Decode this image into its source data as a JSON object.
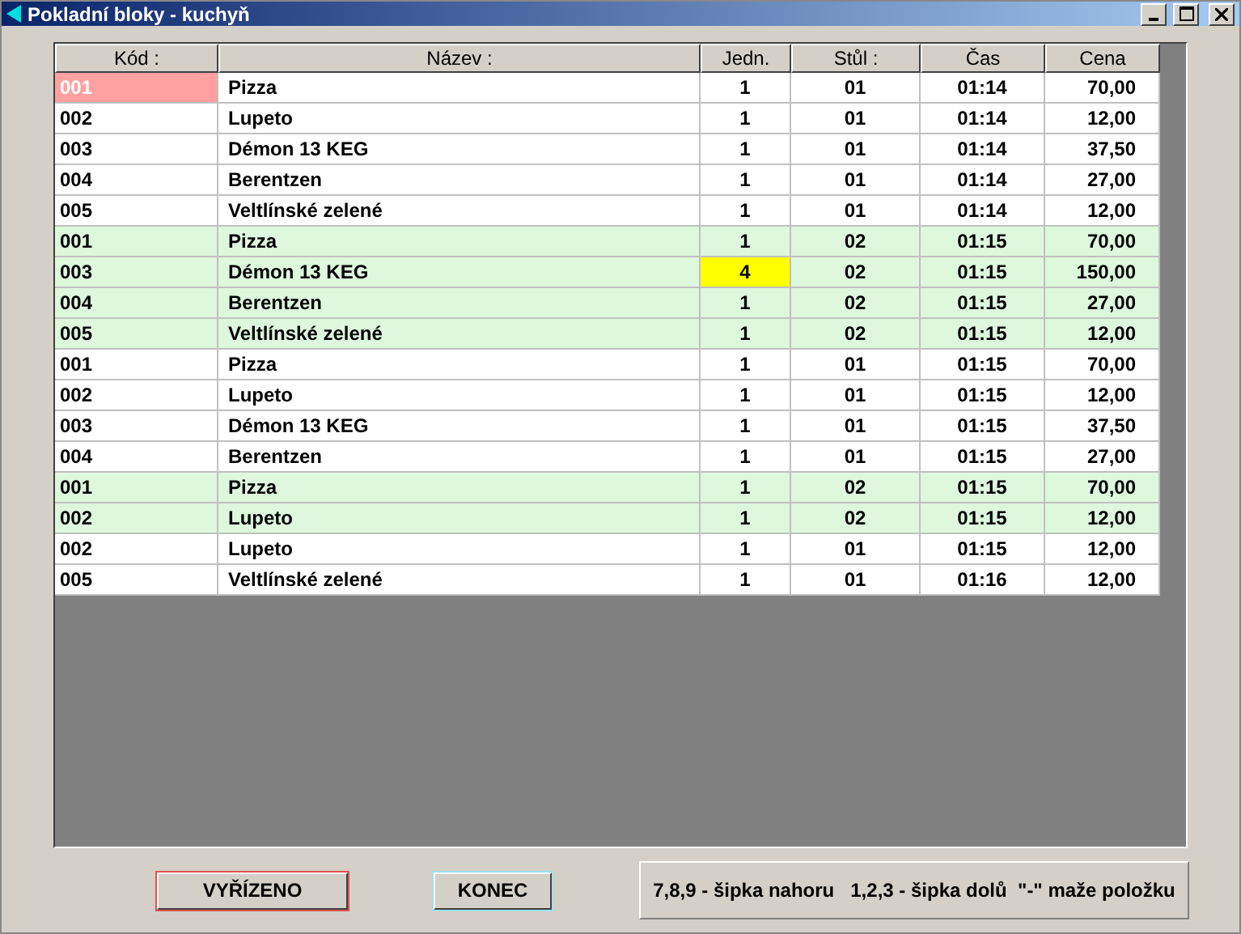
{
  "window": {
    "title": "Pokladní bloky - kuchyň"
  },
  "table": {
    "columns": [
      "Kód :",
      "Název :",
      "Jedn.",
      "Stůl :",
      "Čas",
      "Cena"
    ],
    "rows": [
      {
        "code": "001",
        "name": "Pizza",
        "qty": "1",
        "table": "01",
        "time": "01:14",
        "price": "70,00",
        "color": "#ffffff",
        "code_selected": true,
        "qty_selected": false
      },
      {
        "code": "002",
        "name": "Lupeto",
        "qty": "1",
        "table": "01",
        "time": "01:14",
        "price": "12,00",
        "color": "#ffffff",
        "code_selected": false,
        "qty_selected": false
      },
      {
        "code": "003",
        "name": "Démon 13 KEG",
        "qty": "1",
        "table": "01",
        "time": "01:14",
        "price": "37,50",
        "color": "#ffffff",
        "code_selected": false,
        "qty_selected": false
      },
      {
        "code": "004",
        "name": "Berentzen",
        "qty": "1",
        "table": "01",
        "time": "01:14",
        "price": "27,00",
        "color": "#ffffff",
        "code_selected": false,
        "qty_selected": false
      },
      {
        "code": "005",
        "name": "Veltlínské zelené",
        "qty": "1",
        "table": "01",
        "time": "01:14",
        "price": "12,00",
        "color": "#ffffff",
        "code_selected": false,
        "qty_selected": false
      },
      {
        "code": "001",
        "name": "Pizza",
        "qty": "1",
        "table": "02",
        "time": "01:15",
        "price": "70,00",
        "color": "#ddf8dd",
        "code_selected": false,
        "qty_selected": false
      },
      {
        "code": "003",
        "name": "Démon 13 KEG",
        "qty": "4",
        "table": "02",
        "time": "01:15",
        "price": "150,00",
        "color": "#ddf8dd",
        "code_selected": false,
        "qty_selected": true
      },
      {
        "code": "004",
        "name": "Berentzen",
        "qty": "1",
        "table": "02",
        "time": "01:15",
        "price": "27,00",
        "color": "#ddf8dd",
        "code_selected": false,
        "qty_selected": false
      },
      {
        "code": "005",
        "name": "Veltlínské zelené",
        "qty": "1",
        "table": "02",
        "time": "01:15",
        "price": "12,00",
        "color": "#ddf8dd",
        "code_selected": false,
        "qty_selected": false
      },
      {
        "code": "001",
        "name": "Pizza",
        "qty": "1",
        "table": "01",
        "time": "01:15",
        "price": "70,00",
        "color": "#ffffff",
        "code_selected": false,
        "qty_selected": false
      },
      {
        "code": "002",
        "name": "Lupeto",
        "qty": "1",
        "table": "01",
        "time": "01:15",
        "price": "12,00",
        "color": "#ffffff",
        "code_selected": false,
        "qty_selected": false
      },
      {
        "code": "003",
        "name": "Démon 13 KEG",
        "qty": "1",
        "table": "01",
        "time": "01:15",
        "price": "37,50",
        "color": "#ffffff",
        "code_selected": false,
        "qty_selected": false
      },
      {
        "code": "004",
        "name": "Berentzen",
        "qty": "1",
        "table": "01",
        "time": "01:15",
        "price": "27,00",
        "color": "#ffffff",
        "code_selected": false,
        "qty_selected": false
      },
      {
        "code": "001",
        "name": "Pizza",
        "qty": "1",
        "table": "02",
        "time": "01:15",
        "price": "70,00",
        "color": "#ddf8dd",
        "code_selected": false,
        "qty_selected": false
      },
      {
        "code": "002",
        "name": "Lupeto",
        "qty": "1",
        "table": "02",
        "time": "01:15",
        "price": "12,00",
        "color": "#ddf8dd",
        "code_selected": false,
        "qty_selected": false
      },
      {
        "code": "002",
        "name": "Lupeto",
        "qty": "1",
        "table": "01",
        "time": "01:15",
        "price": "12,00",
        "color": "#ffffff",
        "code_selected": false,
        "qty_selected": false
      },
      {
        "code": "005",
        "name": "Veltlínské zelené",
        "qty": "1",
        "table": "01",
        "time": "01:16",
        "price": "12,00",
        "color": "#ffffff",
        "code_selected": false,
        "qty_selected": false
      }
    ]
  },
  "buttons": [
    {
      "label": "VYŘÍZENO",
      "focused": true
    },
    {
      "label": "KONEC",
      "focused": false
    }
  ],
  "help": "7,8,9 - šipka nahoru   1,2,3 - šipka dolů  \"-\" maže položku"
}
